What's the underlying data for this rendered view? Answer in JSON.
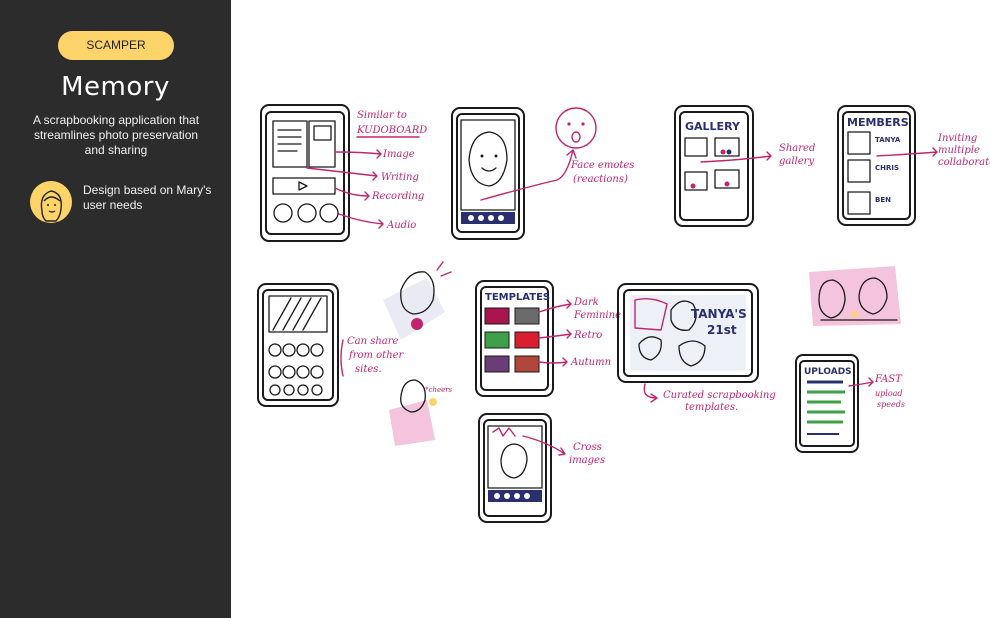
{
  "sidebar": {
    "badge": "SCAMPER",
    "title": "Memory",
    "description": "A scrapbooking application that streamlines photo preservation and sharing",
    "persona_text": "Design based on Mary's user needs"
  },
  "annotations": {
    "similar": "Similar to",
    "kudoboard": "KUDOBOARD",
    "image": "Image",
    "writing": "Writing",
    "recording": "Recording",
    "audio": "Audio",
    "face_emotes": "Face emotes",
    "reactions": "(reactions)",
    "shared": "Shared",
    "gallery_word": "gallery",
    "inviting": "Inviting",
    "multiple": "multiple",
    "collaborators": "collaborators.",
    "can_share": "Can share",
    "from_other": "from other",
    "sites": "sites.",
    "dark_feminine": "Dark",
    "feminine": "Feminine",
    "retro": "Retro",
    "autumn": "Autumn",
    "curated": "Curated scrapbooking",
    "templates_word": "templates.",
    "cross": "Cross",
    "images": "images",
    "fast": "FAST",
    "upload": "upload",
    "speeds": "speeds",
    "cheers": "*cheers"
  },
  "screens": {
    "gallery_title": "GALLERY",
    "members_title": "MEMBERS",
    "member1": "TANYA",
    "member2": "CHRIS",
    "member3": "BEN",
    "templates_title": "TEMPLATES",
    "poster_text": "TANYA'S",
    "poster_sub": "21st",
    "uploads_title": "UPLOADS"
  }
}
